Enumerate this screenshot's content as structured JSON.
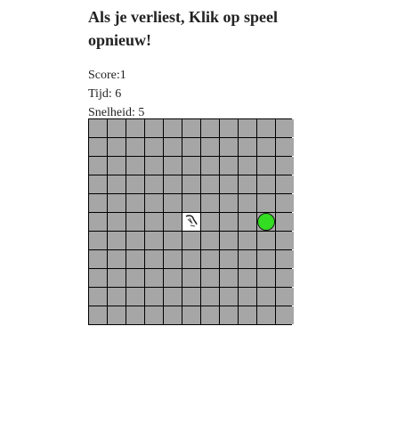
{
  "header": {
    "title": "Als je verliest, Klik op speel opnieuw!"
  },
  "stats": {
    "score_label": "Score:",
    "score_value": "1",
    "time_label": "Tijd:",
    "time_value": "6",
    "speed_label": "Snelheid:",
    "speed_value": "5"
  },
  "board": {
    "rows": 11,
    "cols": 11,
    "cell_color": "#a6a6a6",
    "grid_line_color": "#000000",
    "snake_head": {
      "row": 5,
      "col": 5,
      "icon": "snake-head-icon"
    },
    "food": {
      "row": 5,
      "col": 9,
      "color": "#33dd22",
      "icon": "apple-icon"
    }
  }
}
